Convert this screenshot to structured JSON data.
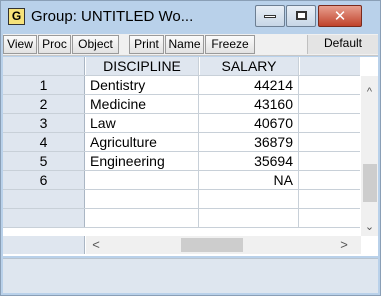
{
  "window": {
    "app_icon_letter": "G",
    "title": "Group: UNTITLED   Wo...",
    "close_glyph": "✕"
  },
  "toolbar": {
    "buttons": [
      "View",
      "Proc",
      "Object",
      "Print",
      "Name",
      "Freeze"
    ],
    "default_label": "Default"
  },
  "table": {
    "columns": [
      "DISCIPLINE",
      "SALARY"
    ],
    "rows": [
      {
        "n": "1",
        "discipline": "Dentistry",
        "salary": "44214"
      },
      {
        "n": "2",
        "discipline": "Medicine",
        "salary": "43160"
      },
      {
        "n": "3",
        "discipline": "Law",
        "salary": "40670"
      },
      {
        "n": "4",
        "discipline": "Agriculture",
        "salary": "36879"
      },
      {
        "n": "5",
        "discipline": "Engineering",
        "salary": "35694"
      },
      {
        "n": "6",
        "discipline": "",
        "salary": "NA"
      }
    ]
  },
  "scroll": {
    "up": "^",
    "down": "⌄",
    "left": "<",
    "right": ">"
  }
}
